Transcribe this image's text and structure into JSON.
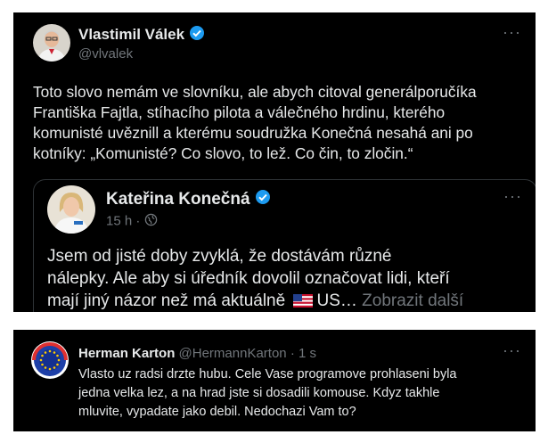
{
  "post": {
    "author_name": "Vlastimil Válek",
    "handle": "@vlvalek",
    "more_label": "···",
    "text_lines": [
      "Toto slovo nemám ve slovníku, ale abych citoval generálporučíka",
      "Františka Fajtla, stíhacího pilota a válečného hrdinu, kterého",
      "komunisté uvěznill a kterému soudružka Konečná nesahá ani po",
      "kotníky: „Komunisté? Co slovo, to lež. Co čin, to zločin.“"
    ]
  },
  "quoted": {
    "author_name": "Kateřina Konečná",
    "time": "15 h",
    "more_label": "···",
    "text_lines": [
      "Jsem od jisté doby zvyklá, že dostávám různé",
      "nálepky. Ale aby si úředník dovolil označovat lidi, kteří",
      "mají jiný názor než má aktuálně"
    ],
    "text_tail": "US…",
    "show_more": "Zobrazit další"
  },
  "reply": {
    "author_name": "Herman Karton",
    "handle": "@HermannKarton",
    "time": "· 1 s",
    "more_label": "···",
    "text_lines": [
      "Vlasto uz radsi drzte hubu. Cele Vase programove prohlaseni byla",
      "jedna velka lez, a na hrad jste si dosadili komouse. Kdyz takhle",
      "mluvite, vypadate jako debil. Nedochazi Vam to?"
    ]
  },
  "colors": {
    "background": "#000000",
    "text": "#e7e9ea",
    "muted": "#71767b",
    "verified": "#1d9bf0",
    "border": "#2f3336"
  }
}
